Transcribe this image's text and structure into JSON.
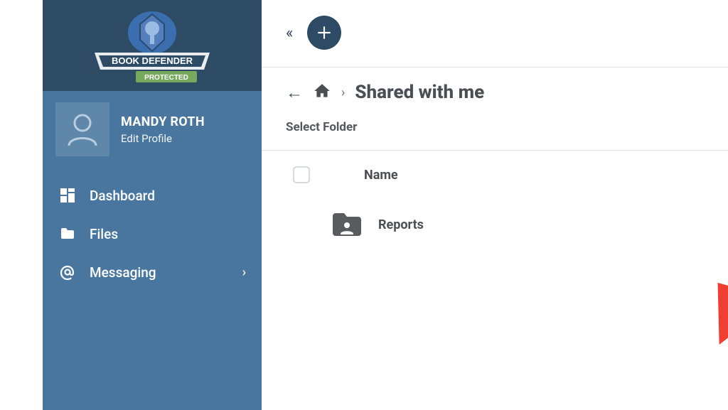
{
  "logo": {
    "title": "BOOK DEFENDER",
    "badge": "PROTECTED"
  },
  "profile": {
    "name": "MANDY ROTH",
    "edit_label": "Edit Profile"
  },
  "nav": {
    "dashboard": "Dashboard",
    "files": "Files",
    "messaging": "Messaging"
  },
  "breadcrumb": {
    "current": "Shared with me",
    "select_label": "Select Folder"
  },
  "table": {
    "name_header": "Name"
  },
  "rows": {
    "reports": "Reports"
  }
}
